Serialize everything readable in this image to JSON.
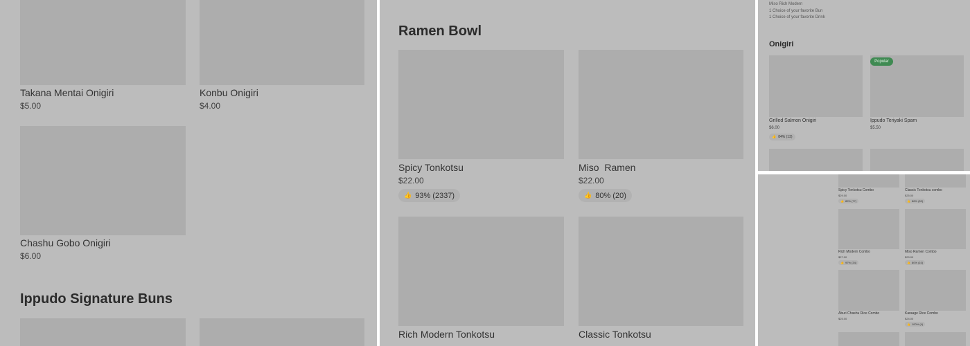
{
  "panel1": {
    "items": [
      {
        "name": "Takana Mentai Onigiri",
        "price": "$5.00"
      },
      {
        "name": "Konbu Onigiri",
        "price": "$4.00"
      },
      {
        "name": "Chashu Gobo Onigiri",
        "price": "$6.00"
      }
    ],
    "section_title": "Ippudo Signature Buns"
  },
  "panel2": {
    "section_title": "Ramen Bowl",
    "items": [
      {
        "name": "Spicy Tonkotsu",
        "price": "$22.00",
        "rating": "93% (2337)"
      },
      {
        "name": "Miso  Ramen",
        "price": "$22.00",
        "rating": "80% (20)"
      },
      {
        "name": "Rich Modern Tonkotsu"
      },
      {
        "name": "Classic Tonkotsu"
      }
    ]
  },
  "panel3": {
    "combo_lines": [
      "Miso Rich Modern",
      "1 Choice of your favorite Bun",
      "1 Choice of your favorite Drink"
    ],
    "section_title": "Onigiri",
    "badge": "Popular",
    "items": [
      {
        "name": "Grilled Salmon Onigiri",
        "price": "$6.00",
        "rating": "84% (13)"
      },
      {
        "name": "Ippudo Teriyaki Spam",
        "price": "$5.50"
      }
    ]
  },
  "panel4": {
    "items": [
      {
        "name": "Spicy Tonkotsu Combo",
        "price": "$29.00",
        "rating": "89% (77)"
      },
      {
        "name": "Classic Tonkotsu combo",
        "price": "$25.00",
        "rating": "86% (52)"
      },
      {
        "name": "Rich Modern Combo",
        "price": "$27.00",
        "rating": "97% (34)"
      },
      {
        "name": "Miso Ramen Combo",
        "price": "$29.00",
        "rating": "80% (10)"
      },
      {
        "name": "Aburi Chashu Rice Combo",
        "price": "$25.00"
      },
      {
        "name": "Karaage Rice Combo",
        "price": "$24.00",
        "rating": "100% (4)"
      }
    ]
  },
  "icons": {
    "thumbs_up": "👍"
  }
}
